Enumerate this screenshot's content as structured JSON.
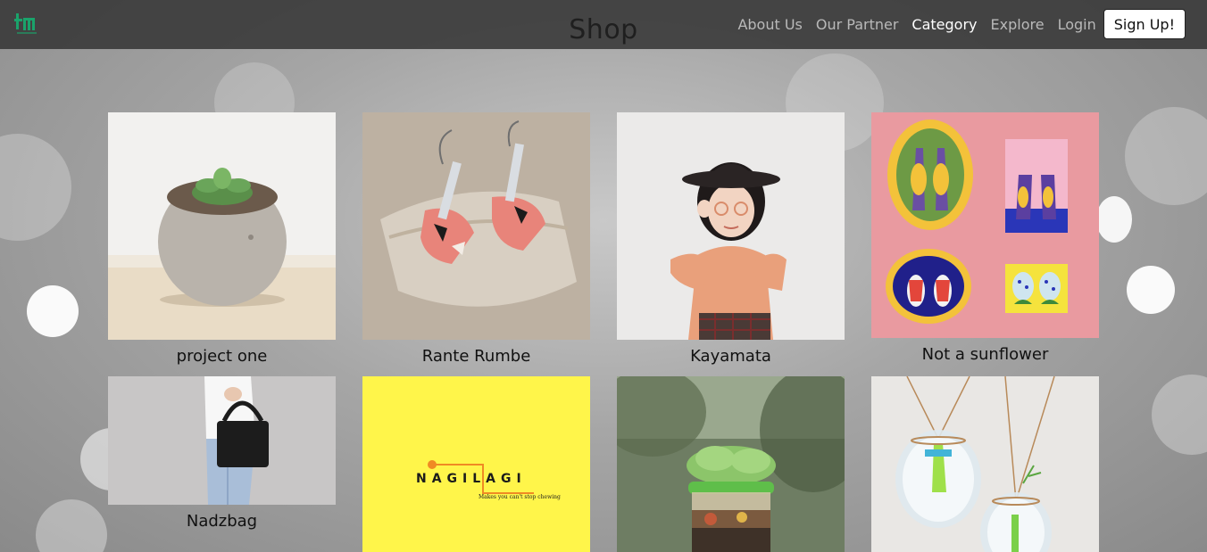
{
  "header": {
    "title": "Shop",
    "logo_icon": "logo-icon",
    "nav": [
      {
        "label": "About Us",
        "active": false
      },
      {
        "label": "Our Partner",
        "active": false
      },
      {
        "label": "Category",
        "active": true
      },
      {
        "label": "Explore",
        "active": false
      },
      {
        "label": "Login",
        "active": false
      }
    ],
    "signup_label": "Sign Up!"
  },
  "products": [
    {
      "name": "project one"
    },
    {
      "name": "Rante Rumbe"
    },
    {
      "name": "Kayamata"
    },
    {
      "name": "Not a sunflower"
    },
    {
      "name": "Nadzbag"
    },
    {
      "name": ""
    },
    {
      "name": ""
    },
    {
      "name": ""
    }
  ],
  "nagilagi": {
    "brand": "NAGILAGI",
    "tagline": "Makes you can't stop chewing"
  },
  "colors": {
    "navbar": "#373737",
    "accent_orange": "#f08a24",
    "logo_green": "#1aa36b",
    "yellow_tile": "#fff54a"
  }
}
